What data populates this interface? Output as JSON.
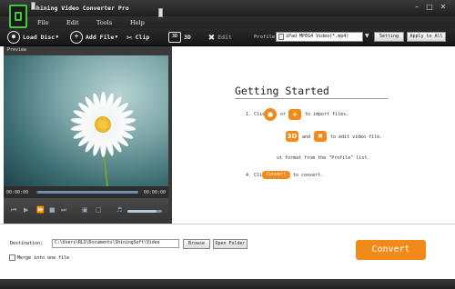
{
  "window": {
    "title": "Shining Video Converter Pro",
    "min_glyph": "–",
    "max_glyph": "□",
    "close_glyph": "✕"
  },
  "menu": [
    "File",
    "Edit",
    "Tools",
    "Help"
  ],
  "toolbar": {
    "load_disc": "Load Disc",
    "add_file": "Add File",
    "clip": "Clip",
    "three_d": "3D",
    "edit": "Edit",
    "profile_label": "Profile",
    "profile_value": "iPad MPEG4 Video(*.mp4)",
    "setting": "Setting",
    "apply_to_all": "Apply to All"
  },
  "preview": {
    "label": "Preview",
    "time_current": "00:00:00",
    "time_total": "00:00:00",
    "seek_progress": 0.02,
    "volume_level": 0.85
  },
  "getting_started": {
    "title": "Getting Started",
    "step1_prefix": "1. Click",
    "step1_or": "or",
    "step1_suffix": "to import files.",
    "step2_and": "and",
    "step2_suffix": "to edit video file.",
    "step3": "ut format from the \"Profile\" list.",
    "step4_prefix": "4. Click",
    "step4_chip": "Convert",
    "step4_suffix": "to convert."
  },
  "bottom": {
    "destination_label": "Destination:",
    "destination_value": "C:\\Users\\RLS\\Documents\\ShiningSoft\\Video",
    "browse": "Browse",
    "open_folder": "Open Folder",
    "merge_label": "Merge into one file",
    "merge_checked": false,
    "convert": "Convert"
  },
  "colors": {
    "accent_orange": "#f28a1a",
    "logo_green": "#43c63a",
    "toolbar_dark": "#1e1e1e"
  }
}
